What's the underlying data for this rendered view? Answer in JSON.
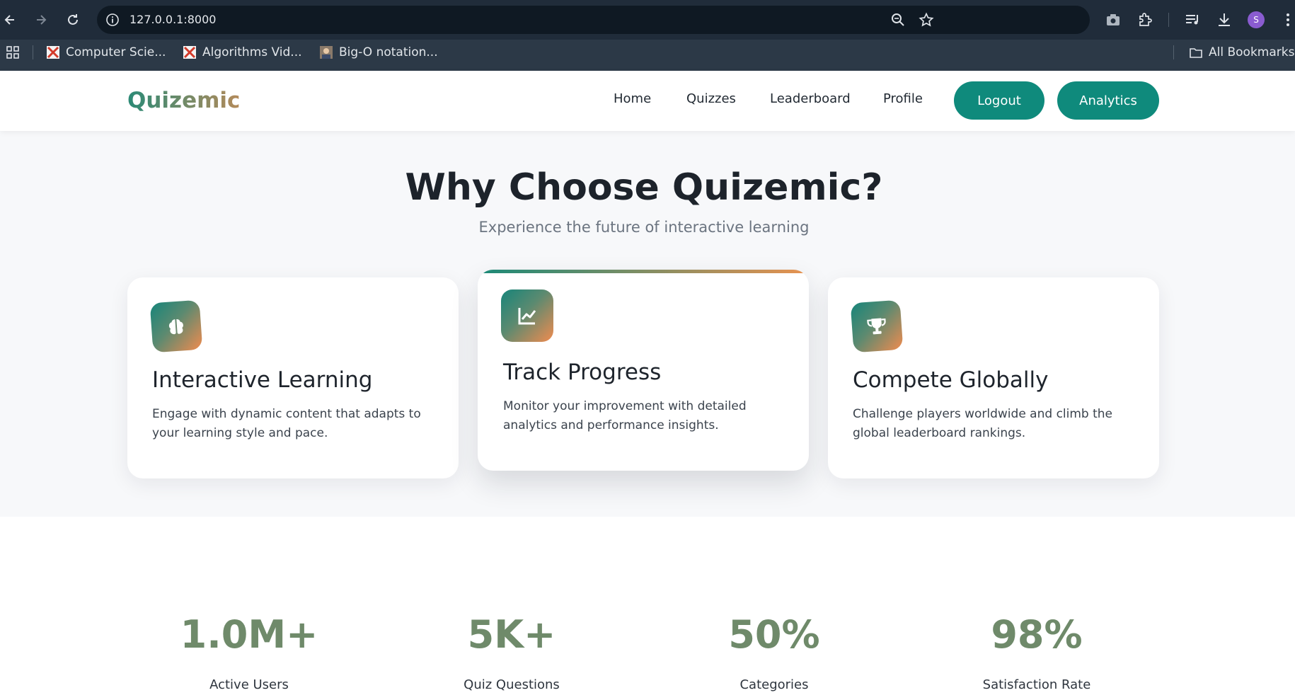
{
  "browser": {
    "url": "127.0.0.1:8000",
    "bookmarks": [
      {
        "label": "Computer Scie..."
      },
      {
        "label": "Algorithms Vid..."
      },
      {
        "label": "Big-O notation..."
      }
    ],
    "all_bookmarks_label": "All Bookmarks",
    "profile_initial": "S"
  },
  "site": {
    "logo": "Quizemic",
    "nav": {
      "home": "Home",
      "quizzes": "Quizzes",
      "leaderboard": "Leaderboard",
      "profile": "Profile",
      "logout": "Logout",
      "analytics": "Analytics"
    },
    "colors": {
      "accent": "#0f8a7c",
      "gradient_start": "#17857a",
      "gradient_end": "#f08b4f"
    }
  },
  "features": {
    "title": "Why Choose Quizemic?",
    "subtitle": "Experience the future of interactive learning",
    "cards": [
      {
        "icon": "brain-icon",
        "title": "Interactive Learning",
        "description": "Engage with dynamic content that adapts to your learning style and pace."
      },
      {
        "icon": "chart-line-icon",
        "title": "Track Progress",
        "description": "Monitor your improvement with detailed analytics and performance insights."
      },
      {
        "icon": "trophy-icon",
        "title": "Compete Globally",
        "description": "Challenge players worldwide and climb the global leaderboard rankings."
      }
    ]
  },
  "stats": [
    {
      "value": "1.0M+",
      "label": "Active Users"
    },
    {
      "value": "5K+",
      "label": "Quiz Questions"
    },
    {
      "value": "50%",
      "label": "Categories"
    },
    {
      "value": "98%",
      "label": "Satisfaction Rate"
    }
  ]
}
